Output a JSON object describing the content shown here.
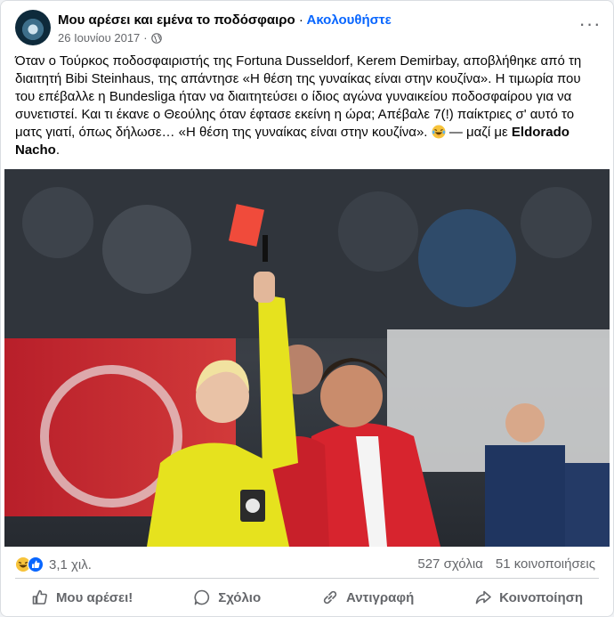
{
  "post": {
    "page_name": "Μου αρέσει και εμένα το ποδόσφαιρο",
    "separator": "·",
    "follow_label": "Ακολουθήστε",
    "date": "26 Ιουνίου 2017",
    "meta_separator": "·",
    "more_label": "···",
    "text_main": "Όταν ο Τούρκος ποδοσφαιριστής της Fortuna Dusseldorf, Kerem Demirbay, αποβλήθηκε από τη διαιτητή Bibi Steinhaus, της απάντησε «Η θέση της γυναίκας είναι στην κουζίνα». Η τιμωρία που του επέβαλλε η Bundesliga ήταν να διαιτητεύσει ο ίδιος αγώνα γυναικείου ποδοσφαίρου για να συνετιστεί. Και τι έκανε ο Θεούλης όταν έφτασε εκείνη η ώρα; Απέβαλε 7(!) παίκτριες σ' αυτό το ματς γιατί, όπως δήλωσε… «Η θέση της γυναίκας είναι στην κουζίνα».",
    "with_text": "— μαζί με",
    "tagged_name": "Eldorado Nacho",
    "end_punct": "."
  },
  "stats": {
    "reactions_count": "3,1 χιλ.",
    "comments": "527 σχόλια",
    "shares": "51 κοινοποιήσεις"
  },
  "actions": {
    "like": "Μου αρέσει!",
    "comment": "Σχόλιο",
    "copy": "Αντιγραφή",
    "share": "Κοινοποίηση"
  },
  "colors": {
    "brand_blue": "#0866ff",
    "text_primary": "#050505",
    "text_secondary": "#65676b",
    "referee_kit": "#e6e21e",
    "red_card": "#f04b3b"
  }
}
